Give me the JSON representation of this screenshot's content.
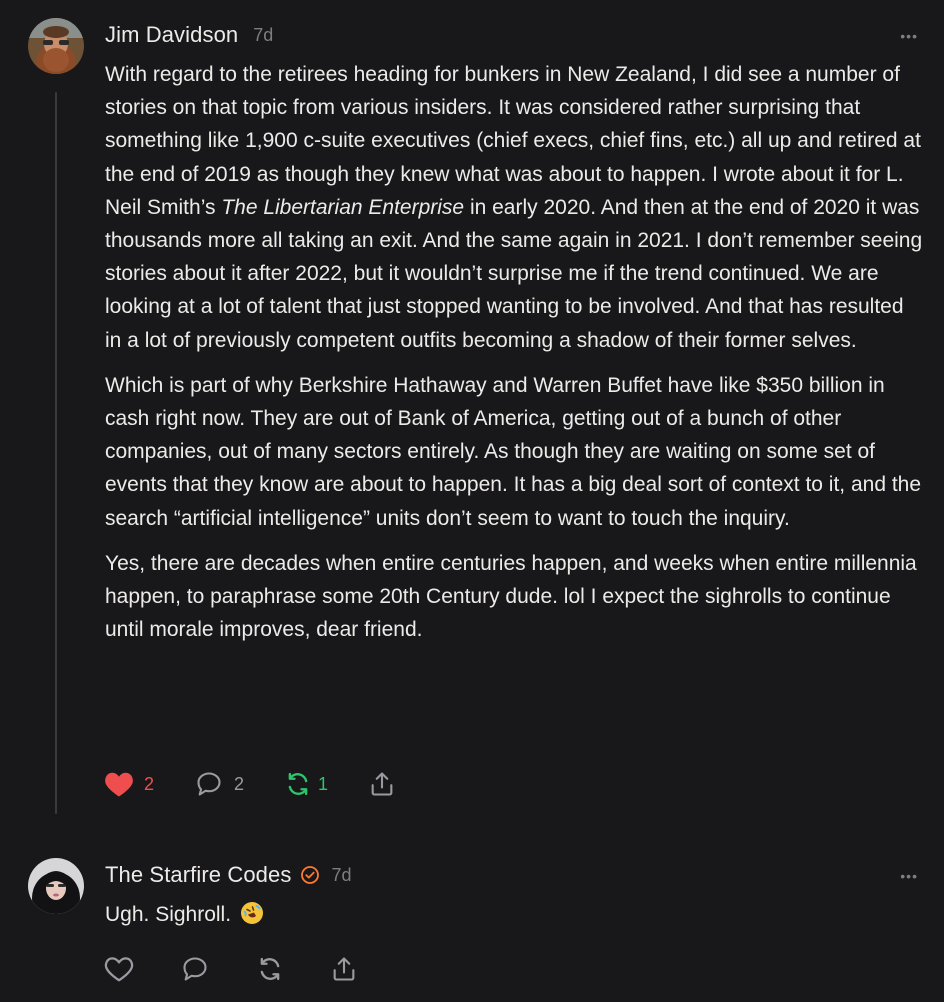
{
  "comments": [
    {
      "author": "Jim Davidson",
      "time": "7d",
      "more_label": "•••",
      "paragraphs": [
        {
          "before": "With regard to the retirees heading for bunkers in New Zealand, I did see a number of stories on that topic from various insiders. It was considered rather surprising that something like 1,900 c-suite executives (chief execs, chief fins, etc.) all up and retired at the end of 2019 as though they knew what was about to happen. I wrote about it for L. Neil Smith’s ",
          "italic": "The Libertarian Enterprise",
          "after": " in early 2020. And then at the end of 2020 it was thousands more all taking an exit. And the same again in 2021. I don’t remember seeing stories about it after 2022, but it wouldn’t surprise me if the trend continued. We are looking at a lot of talent that just stopped wanting to be involved. And that has resulted in a lot of previously competent outfits becoming a shadow of their former selves."
        },
        "Which is part of why Berkshire Hathaway and Warren Buffet have like $350 billion in cash right now. They are out of Bank of America, getting out of a bunch of other companies, out of many sectors entirely. As though they are waiting on some set of events that they know are about to happen. It has a big deal sort of context to it, and the search “artificial intelligence” units don’t seem to want to touch the inquiry.",
        "Yes, there are decades when entire centuries happen, and weeks when entire millennia happen, to paraphrase some 20th Century dude. lol I expect the sighrolls to continue until morale improves, dear friend."
      ],
      "likes": "2",
      "replies": "2",
      "restacks": "1",
      "liked": true,
      "restacked": true
    },
    {
      "author": "The Starfire Codes",
      "time": "7d",
      "more_label": "•••",
      "text": "Ugh. Sighroll.",
      "emoji": "rolling-on-floor-laughing",
      "verified": true
    }
  ],
  "colors": {
    "background": "#18181b",
    "text": "#ecebe8",
    "muted": "#7d7d83",
    "like": "#ef4e4e",
    "restack": "#2fc46b",
    "verified": "#ff7a2f"
  }
}
